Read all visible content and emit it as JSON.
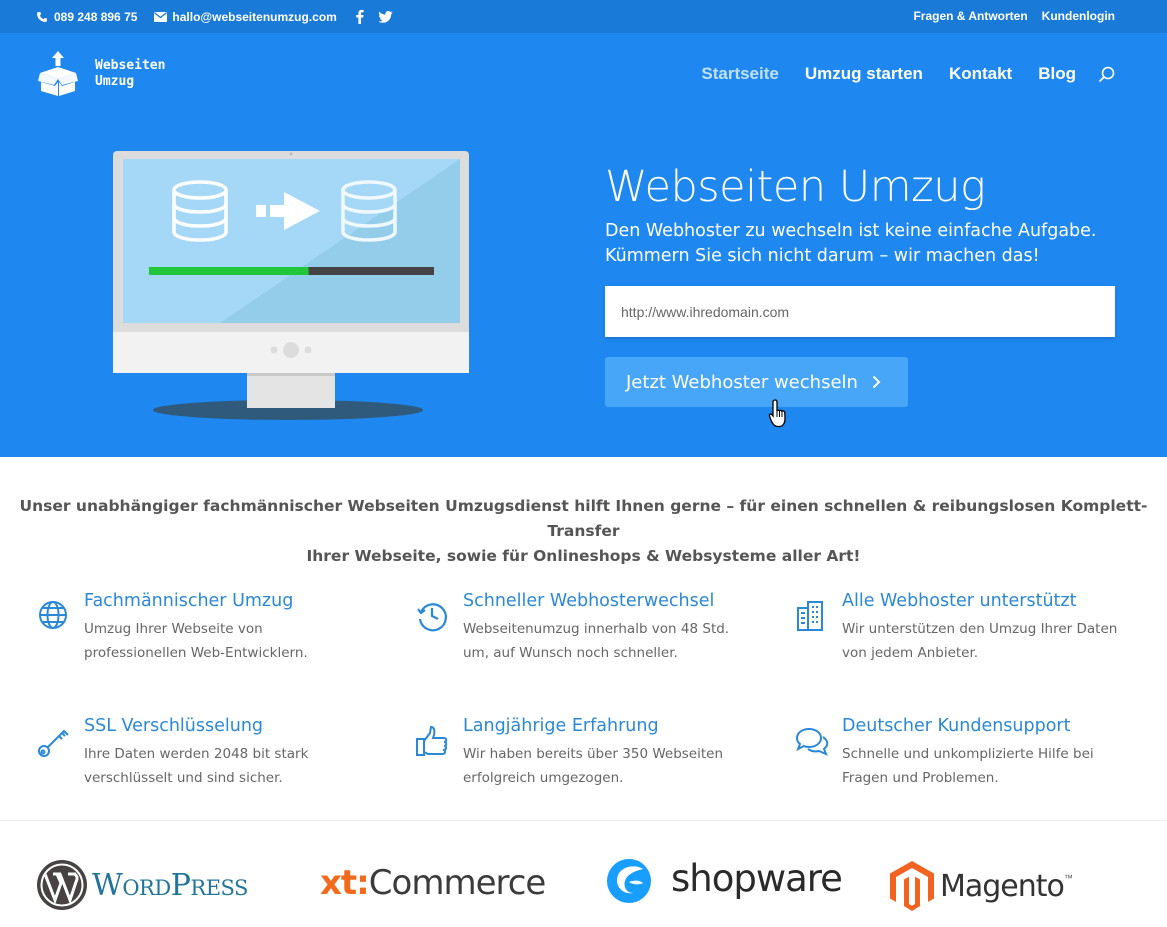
{
  "topbar": {
    "phone": "089 248 896 75",
    "email": "hallo@webseitenumzug.com",
    "links": [
      "Fragen & Antworten",
      "Kundenlogin"
    ]
  },
  "logo": {
    "line1": "Webseiten",
    "line2": "Umzug"
  },
  "nav": {
    "items": [
      "Startseite",
      "Umzug starten",
      "Kontakt",
      "Blog"
    ]
  },
  "hero": {
    "title": "Webseiten Umzug",
    "subtitle1": "Den Webhoster zu wechseln ist keine einfache Aufgabe.",
    "subtitle2": "Kümmern Sie sich nicht darum – wir machen das!",
    "url_placeholder": "http://www.ihredomain.com",
    "cta": "Jetzt Webhoster wechseln",
    "transfer_progress": 0.56
  },
  "intro": {
    "line1": "Unser  unabhängiger fachmännischer Webseiten Umzugsdienst hilft Ihnen gerne – für einen schnellen & reibungslosen Komplett-Transfer",
    "line2": "Ihrer Webseite, sowie für Onlineshops & Websysteme aller Art!"
  },
  "features": [
    {
      "icon": "globe-icon",
      "title": "Fachmännischer Umzug",
      "desc1": "Umzug Ihrer Webseite von",
      "desc2": "professionellen Web-Entwicklern."
    },
    {
      "icon": "history-icon",
      "title": "Schneller Webhosterwechsel",
      "desc1": "Webseitenumzug innerhalb von 48 Std.",
      "desc2": "um, auf Wunsch noch schneller."
    },
    {
      "icon": "building-icon",
      "title": "Alle Webhoster unterstützt",
      "desc1": "Wir unterstützen den Umzug Ihrer Daten",
      "desc2": "von jedem Anbieter."
    },
    {
      "icon": "key-icon",
      "title": "SSL Verschlüsselung",
      "desc1": "Ihre Daten werden 2048 bit stark",
      "desc2": "verschlüsselt und sind sicher."
    },
    {
      "icon": "thumbs-up-icon",
      "title": "Langjährige Erfahrung",
      "desc1": "Wir haben bereits über 350 Webseiten",
      "desc2": "erfolgreich umgezogen."
    },
    {
      "icon": "chat-icon",
      "title": "Deutscher Kundensupport",
      "desc1": "Schnelle und unkomplizierte Hilfe bei",
      "desc2": "Fragen und Problemen."
    }
  ],
  "brands": {
    "wordpress": "WordPress",
    "xt_prefix": "xt:",
    "xt_suffix": "Commerce",
    "shopware": "shopware",
    "magento": "Magento",
    "magento_tm": "™"
  },
  "colors": {
    "accent": "#1e88f0",
    "topbar": "#1a7ad8",
    "button": "#47a6f8",
    "feature_title": "#2a88d8",
    "progress": "#22c63a"
  }
}
